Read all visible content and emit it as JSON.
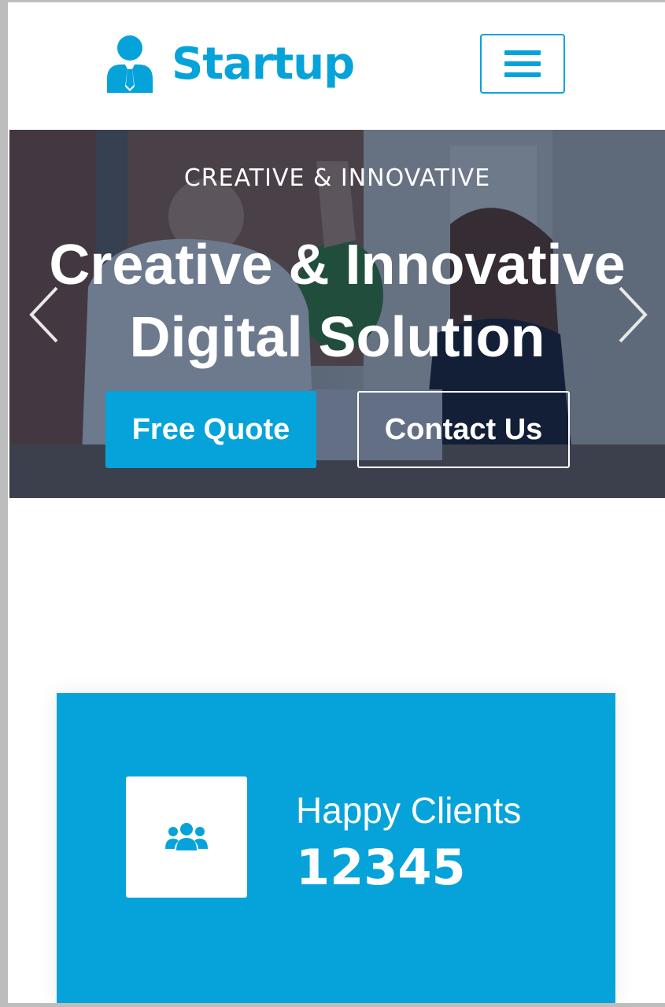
{
  "navbar": {
    "brand_text": "Startup",
    "brand_icon": "user-tie-icon",
    "toggler_icon": "hamburger-menu-icon"
  },
  "hero": {
    "subtitle": "CREATIVE & INNOVATIVE",
    "title_line1": "Creative & Innovative",
    "title_line2": "Digital Solution",
    "primary_button": "Free Quote",
    "secondary_button": "Contact Us",
    "prev_icon": "chevron-left-icon",
    "next_icon": "chevron-right-icon"
  },
  "stats": {
    "label": "Happy Clients",
    "value": "12345",
    "icon": "users-icon"
  },
  "colors": {
    "primary": "#06a3da",
    "overlay": "#091e3e",
    "white": "#ffffff"
  }
}
